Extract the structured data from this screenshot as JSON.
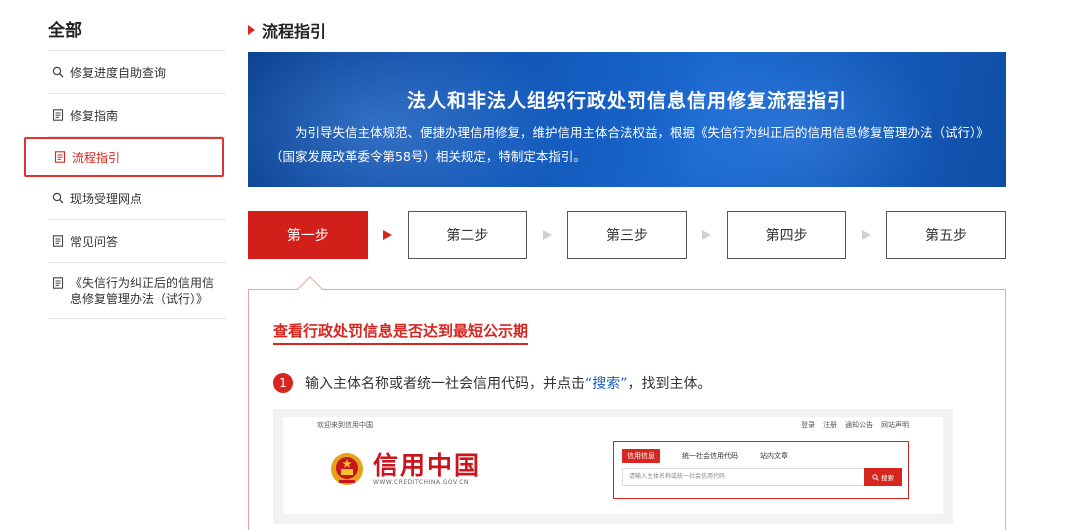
{
  "sidebar": {
    "title": "全部",
    "items": [
      {
        "label": "修复进度自助查询",
        "icon": "search-icon"
      },
      {
        "label": "修复指南",
        "icon": "document-icon"
      },
      {
        "label": "流程指引",
        "icon": "document-icon"
      },
      {
        "label": "现场受理网点",
        "icon": "search-icon"
      },
      {
        "label": "常见问答",
        "icon": "document-icon"
      },
      {
        "label": "《失信行为纠正后的信用信息修复管理办法（试行）》",
        "icon": "document-icon"
      }
    ]
  },
  "section": {
    "title": "流程指引"
  },
  "banner": {
    "title": "法人和非法人组织行政处罚信息信用修复流程指引",
    "desc": "为引导失信主体规范、便捷办理信用修复，维护信用主体合法权益，根据《失信行为纠正后的信用信息修复管理办法（试行）》（国家发展改革委令第58号）相关规定，特制定本指引。"
  },
  "steps": [
    "第一步",
    "第二步",
    "第三步",
    "第四步",
    "第五步"
  ],
  "panel": {
    "title": "查看行政处罚信息是否达到最短公示期",
    "instr_num": "1",
    "instr_before": "输入主体名称或者统一社会信用代码，并点击",
    "instr_highlight": "“搜索”",
    "instr_after": "，找到主体。"
  },
  "mock": {
    "welcome": "欢迎来到信用中国",
    "top_links": [
      "登录",
      "注册",
      "通知公告",
      "网站声明"
    ],
    "brand_cn": "信用中国",
    "brand_en": "WWW.CREDITCHINA.GOV.CN",
    "tabs": [
      "信用信息",
      "统一社会信用代码",
      "站内文章"
    ],
    "input_placeholder": "请输入主体名称或统一社会信用代码",
    "search_button": "搜索"
  },
  "colors": {
    "accent": "#d7261f",
    "banner": "#1257b8",
    "link": "#1f5fbf"
  }
}
